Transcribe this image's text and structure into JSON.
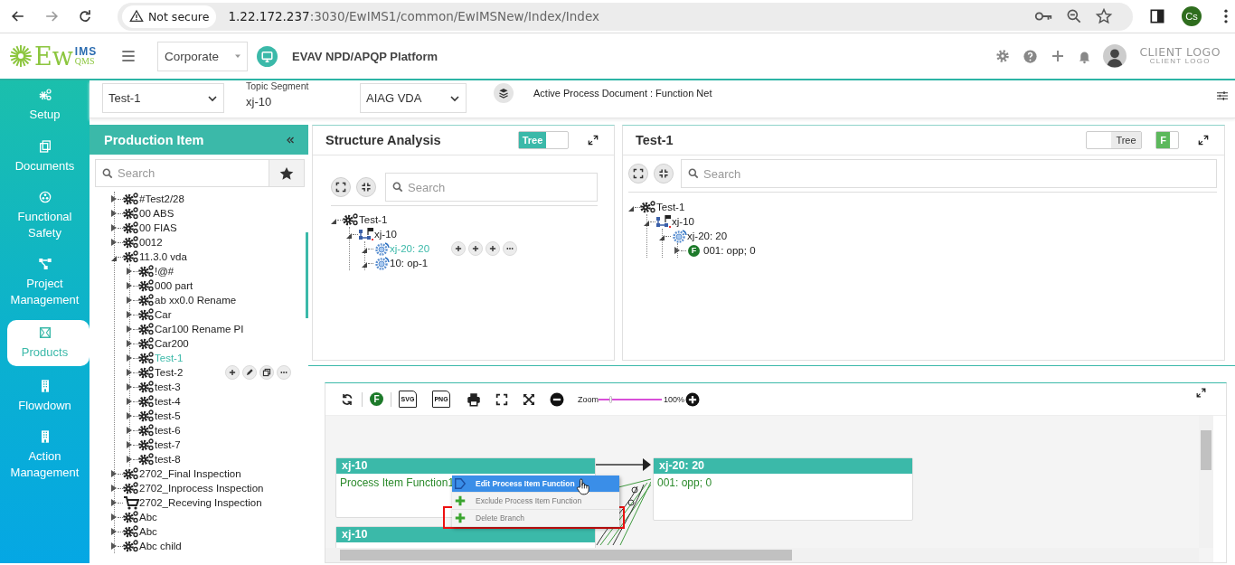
{
  "browser": {
    "security": "Not secure",
    "url_host": "1.22.172.237",
    "url_path": ":3030/EwIMS1/common/EwIMSNew/Index/Index",
    "profile": "Cs"
  },
  "header": {
    "logo": {
      "main": "Ew",
      "top": "IMS",
      "bottom": "QMS"
    },
    "org_select": "Corporate",
    "platform": "EVAV NPD/APQP Platform",
    "client_logo": "CLIENT LOGO",
    "client_logo_sub": "CLIENT LOGO"
  },
  "sidebar": {
    "items": [
      {
        "label": "Setup",
        "kind": "gears",
        "selected": false
      },
      {
        "label": "Documents",
        "kind": "documents",
        "selected": false
      },
      {
        "label": "Functional Safety",
        "kind": "hazard",
        "selected": false
      },
      {
        "label": "Project Management",
        "kind": "hierarchy",
        "selected": false
      },
      {
        "label": "Products",
        "kind": "frame",
        "selected": true
      },
      {
        "label": "Flowdown",
        "kind": "building",
        "selected": false
      },
      {
        "label": "Action Management",
        "kind": "building",
        "selected": false
      }
    ]
  },
  "filter_bar": {
    "item_select": "Test-1",
    "segment_label": "Topic Segment",
    "segment_value": "xj-10",
    "standard_select": "AIAG VDA",
    "active_document": "Active Process Document : Function Net"
  },
  "production_panel": {
    "title": "Production Item",
    "search_placeholder": "Search",
    "tree": [
      {
        "label": "#Test2/28",
        "kind": "gear",
        "expanded": false,
        "selected": false
      },
      {
        "label": "00 ABS",
        "kind": "gear",
        "expanded": false,
        "selected": false
      },
      {
        "label": "00 FIAS",
        "kind": "gear",
        "expanded": false,
        "selected": false
      },
      {
        "label": "0012",
        "kind": "gear",
        "expanded": false,
        "selected": false
      },
      {
        "label": "11.3.0 vda",
        "kind": "gear",
        "expanded": true,
        "selected": false,
        "children": [
          {
            "label": "!@#",
            "kind": "gear",
            "expanded": false,
            "selected": false
          },
          {
            "label": "000 part",
            "kind": "gear",
            "expanded": false,
            "selected": false
          },
          {
            "label": "ab xx0.0 Rename",
            "kind": "gear",
            "expanded": false,
            "selected": false
          },
          {
            "label": "Car",
            "kind": "gear",
            "expanded": false,
            "selected": false
          },
          {
            "label": "Car100 Rename PI",
            "kind": "gear",
            "expanded": false,
            "selected": false
          },
          {
            "label": "Car200",
            "kind": "gear",
            "expanded": false,
            "selected": false
          },
          {
            "label": "Test-1",
            "kind": "gear",
            "expanded": false,
            "selected": true
          },
          {
            "label": "Test-2",
            "kind": "gear",
            "expanded": false,
            "selected": false,
            "actions": [
              {
                "kind": "plus"
              },
              {
                "kind": "edit"
              },
              {
                "kind": "copy"
              },
              {
                "kind": "more"
              }
            ]
          },
          {
            "label": "test-3",
            "kind": "gear",
            "expanded": false,
            "selected": false
          },
          {
            "label": "test-4",
            "kind": "gear",
            "expanded": false,
            "selected": false
          },
          {
            "label": "test-5",
            "kind": "gear",
            "expanded": false,
            "selected": false
          },
          {
            "label": "test-6",
            "kind": "gear",
            "expanded": false,
            "selected": false
          },
          {
            "label": "test-7",
            "kind": "gear",
            "expanded": false,
            "selected": false
          },
          {
            "label": "test-8",
            "kind": "gear",
            "expanded": false,
            "selected": false
          }
        ]
      },
      {
        "label": "2702_Final Inspection",
        "kind": "gear",
        "expanded": false,
        "selected": false
      },
      {
        "label": "2702_Inprocess Inspection",
        "kind": "gear",
        "expanded": false,
        "selected": false
      },
      {
        "label": "2702_Receving Inspection",
        "kind": "cart",
        "expanded": false,
        "selected": false
      },
      {
        "label": "Abc",
        "kind": "gear",
        "expanded": false,
        "selected": false
      },
      {
        "label": "Abc",
        "kind": "gear",
        "expanded": false,
        "selected": false
      },
      {
        "label": "Abc child",
        "kind": "gear",
        "expanded": false,
        "selected": false
      }
    ]
  },
  "structure_panel": {
    "title": "Structure Analysis",
    "toggle": {
      "label": "Tree",
      "on": true
    },
    "search_placeholder": "Search",
    "tree": [
      {
        "label": "Test-1",
        "kind": "gear",
        "expanded": true,
        "selected": false,
        "children": [
          {
            "label": "xj-10",
            "kind": "flow",
            "expanded": true,
            "selected": false,
            "children": [
              {
                "label": "xj-20: 20",
                "kind": "process",
                "expanded": true,
                "selected": true,
                "actions": [
                  {
                    "kind": "plus"
                  },
                  {
                    "kind": "plus"
                  },
                  {
                    "kind": "plus"
                  },
                  {
                    "kind": "more"
                  }
                ]
              },
              {
                "label": "10: op-1",
                "kind": "process",
                "expanded": true,
                "selected": false
              }
            ]
          }
        ]
      }
    ]
  },
  "net_panel": {
    "title": "Test-1",
    "toggle": {
      "label": "Tree",
      "on": false
    },
    "f_toggle": {
      "label": "F",
      "on": true
    },
    "search_placeholder": "Search",
    "tree": [
      {
        "label": "Test-1",
        "kind": "gear",
        "expanded": true,
        "selected": false,
        "children": [
          {
            "label": "xj-10",
            "kind": "flow",
            "expanded": true,
            "selected": false,
            "children": [
              {
                "label": "xj-20: 20",
                "kind": "process",
                "expanded": true,
                "selected": false,
                "children": [
                  {
                    "label": "001: opp; 0",
                    "kind": "function",
                    "badge": "F",
                    "expanded": false,
                    "selected": false
                  }
                ]
              }
            ]
          }
        ]
      }
    ]
  },
  "diagram": {
    "toolbar": {
      "badge": "F",
      "svg_label": "SVG",
      "png_label": "PNG",
      "zoom": {
        "label": "Zoom",
        "value": "100%",
        "level": 0.2
      }
    },
    "nodes": [
      {
        "title": "xj-10",
        "function": "Process Item Function1"
      },
      {
        "title": "xj-20: 20",
        "function": "001: opp; 0"
      },
      {
        "title": "xj-10"
      }
    ],
    "context_menu": [
      {
        "label": "Edit Process Item Function",
        "kind": "edit",
        "highlighted": true,
        "flagged": false
      },
      {
        "label": "Exclude Process Item Function",
        "kind": "plus",
        "highlighted": false,
        "flagged": false
      },
      {
        "label": "Delete Branch",
        "kind": "plus",
        "highlighted": false,
        "flagged": true
      }
    ]
  }
}
